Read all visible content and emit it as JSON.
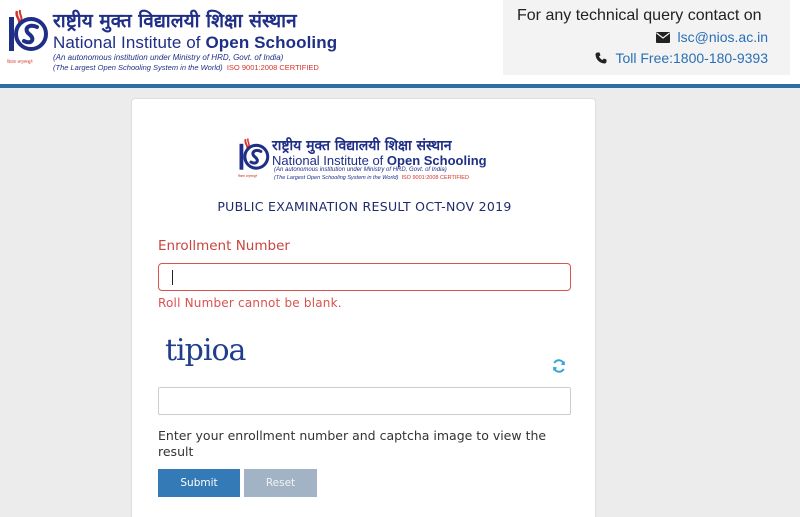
{
  "header": {
    "logo": {
      "hindi_name": "राष्ट्रीय मुक्त विद्यालयी शिक्षा संस्थान",
      "english_name_prefix": "National Institute of ",
      "english_name_bold": "Open Schooling",
      "subtitle_line1": "(An autonomous institution under  Ministry of HRD, Govt. of India)",
      "subtitle_line2": "(The Largest Open Schooling System in the World)",
      "iso": "ISO 9001:2008 CERTIFIED",
      "emblem_tagline": "विद्यया अमृतमश्नुते",
      "brand_color": "#1f2f87",
      "accent_color": "#d5332b"
    },
    "contact": {
      "title": "For any technical query contact on",
      "email_icon": "envelope-icon",
      "email": "lsc@nios.ac.in",
      "phone_icon": "phone-icon",
      "phone": "Toll Free:1800-180-9393",
      "link_color": "#2a6fb5"
    }
  },
  "form": {
    "title": "PUBLIC EXAMINATION RESULT OCT-NOV 2019",
    "enrollment": {
      "label": "Enrollment Number",
      "value": "",
      "placeholder": "",
      "error": "Roll Number cannot be blank."
    },
    "captcha": {
      "image_text": "tipioa",
      "refresh_icon": "refresh-icon",
      "input_value": "",
      "placeholder": ""
    },
    "instructions": "Enter your enrollment number and captcha image to view the result",
    "buttons": {
      "submit": "Submit",
      "reset": "Reset"
    },
    "error_color": "#d9534f",
    "primary_color": "#337ab7"
  }
}
